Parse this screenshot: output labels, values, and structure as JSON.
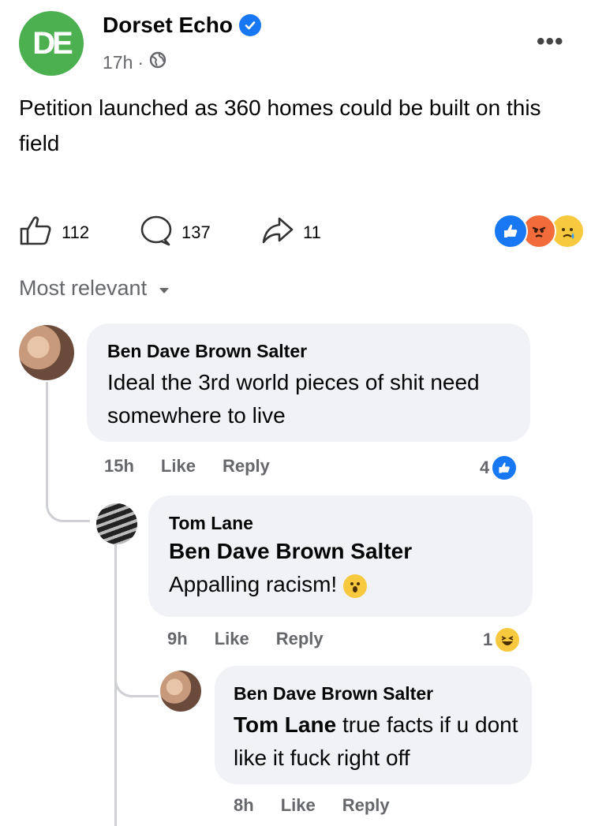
{
  "post": {
    "page_name": "Dorset Echo",
    "page_initials": "DE",
    "time": "17h",
    "meta_separator": "·",
    "text": "Petition launched as 360 homes could be built on this field",
    "likes": "112",
    "comments": "137",
    "shares": "11"
  },
  "sort": {
    "label": "Most relevant"
  },
  "comments": [
    {
      "author": "Ben Dave Brown Salter",
      "text": "Ideal the 3rd world pieces of shit need somewhere to live",
      "time": "15h",
      "like": "Like",
      "reply": "Reply",
      "reaction_count": "4",
      "replies": [
        {
          "author": "Tom Lane",
          "mention": "Ben Dave Brown Salter",
          "text": "Appalling racism!",
          "time": "9h",
          "like": "Like",
          "reply": "Reply",
          "reaction_count": "1",
          "replies": [
            {
              "author": "Ben Dave Brown Salter",
              "mention": "Tom Lane",
              "text": "true facts if u dont like it fuck right off",
              "time": "8h",
              "like": "Like",
              "reply": "Reply"
            }
          ]
        }
      ]
    }
  ],
  "colors": {
    "brand": "#1877f2",
    "avatar_green": "#4caf50",
    "muted": "#65676b",
    "bubble": "#f0f2f5"
  }
}
